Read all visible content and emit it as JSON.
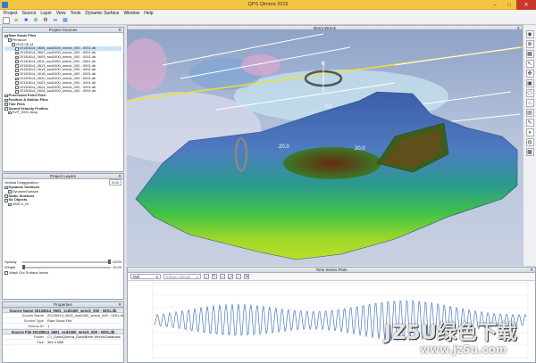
{
  "window": {
    "title": "QPS Qimera 2015"
  },
  "menu": [
    "Project",
    "Source",
    "Layer",
    "View",
    "Tools",
    "Dynamic Surface",
    "Window",
    "Help"
  ],
  "project_sources": {
    "title": "Project Sources",
    "items": [
      {
        "label": "Raw Sonar Files",
        "bold": true,
        "indent": 0
      },
      {
        "label": "Perrauce",
        "bold": false,
        "indent": 1
      },
      {
        "label": "2013.06.14",
        "bold": false,
        "indent": 2
      },
      {
        "label": "20130614_0606_ssd2400_wreck_000 - 0001.db",
        "bold": false,
        "indent": 3,
        "selected": true
      },
      {
        "label": "20130614_0607_ssd2400_wreck_000 - 0001.db",
        "bold": false,
        "indent": 3
      },
      {
        "label": "20130614_0609_ssd2400_wreck_000 - 0001.db",
        "bold": false,
        "indent": 3
      },
      {
        "label": "20130614_0611_ssd2400_wreck_000 - 0001.db",
        "bold": false,
        "indent": 3
      },
      {
        "label": "20130614_0613_ssd2400_wreck_000 - 0001.db",
        "bold": false,
        "indent": 3
      },
      {
        "label": "20130614_0614_ssd2400_wreck_000 - 0001.db",
        "bold": false,
        "indent": 3
      },
      {
        "label": "20130614_0618_ssd2400_wreck_400 - 0001.db",
        "bold": false,
        "indent": 3
      },
      {
        "label": "20130614_0620_ssd2400_wreck_000 - 0001.db",
        "bold": false,
        "indent": 3
      },
      {
        "label": "20130614_0623_ssd2400_wreck_000 - 0001.db",
        "bold": false,
        "indent": 3
      },
      {
        "label": "20130614_0624_ssd2400_wreck_000 - 0001.db",
        "bold": false,
        "indent": 3
      },
      {
        "label": "20130614_0628_ssd2400_wreck_400 - 0001.db",
        "bold": false,
        "indent": 3
      },
      {
        "label": "Processed Point Files",
        "bold": true,
        "indent": 0
      },
      {
        "label": "Position & Motion Files",
        "bold": true,
        "indent": 0
      },
      {
        "label": "Tide Files",
        "bold": true,
        "indent": 0
      },
      {
        "label": "Sound Velocity Profiles",
        "bold": true,
        "indent": 0
      },
      {
        "label": "SVP_0001.bsvp",
        "bold": false,
        "indent": 1
      }
    ]
  },
  "project_layers": {
    "title": "Project Layers",
    "vert_exag_label": "Vertical Exaggeration",
    "vert_exag_value": "6.00",
    "items": [
      {
        "label": "Dynamic Surfaces",
        "bold": true,
        "indent": 0
      },
      {
        "label": "DynamicSurface",
        "bold": false,
        "indent": 1
      },
      {
        "label": "Static Surfaces",
        "bold": true,
        "indent": 0
      },
      {
        "label": "Sd Objects",
        "bold": true,
        "indent": 0
      },
      {
        "label": "3429-0_W",
        "bold": false,
        "indent": 1
      }
    ],
    "opacity_label": "Opacity",
    "opacity_value": "100%",
    "weight_label": "Weight",
    "weight_value": "10.00",
    "mask_label": "Mask Out Surface Areas"
  },
  "properties": {
    "title": "Properties",
    "sections": [
      {
        "header": "Source Name 20130614_0601_ssd2400_wreck_000 - 0001.db",
        "rows": [
          {
            "k": "Source Name",
            "v": "20130614_0601_ssd2400_wreck_000 - 0001.db"
          },
          {
            "k": "Source Type",
            "v": "Raw Sonar File"
          },
          {
            "k": "Source ID",
            "v": "1"
          }
        ]
      },
      {
        "header": "Source File 20130614_0601_ssd2400_wreck_000 - 0001.db",
        "rows": [
          {
            "k": "Folder",
            "v": "C:\\_Data\\Qimera_Data\\Brent Wreck\\Database"
          },
          {
            "k": "Size",
            "v": "384.4 MiB"
          }
        ]
      }
    ]
  },
  "viewport": {
    "title": "Brent Wreck",
    "labels": [
      "20.0",
      "20.0",
      "0.0"
    ]
  },
  "timeseries": {
    "title": "Time Series Plots",
    "dropdown1": "Roll",
    "dropdown2": "Ellipse Altitude"
  },
  "watermark": {
    "line1": "JZ5U绿色下载",
    "line2": "www.jz5u.com"
  }
}
